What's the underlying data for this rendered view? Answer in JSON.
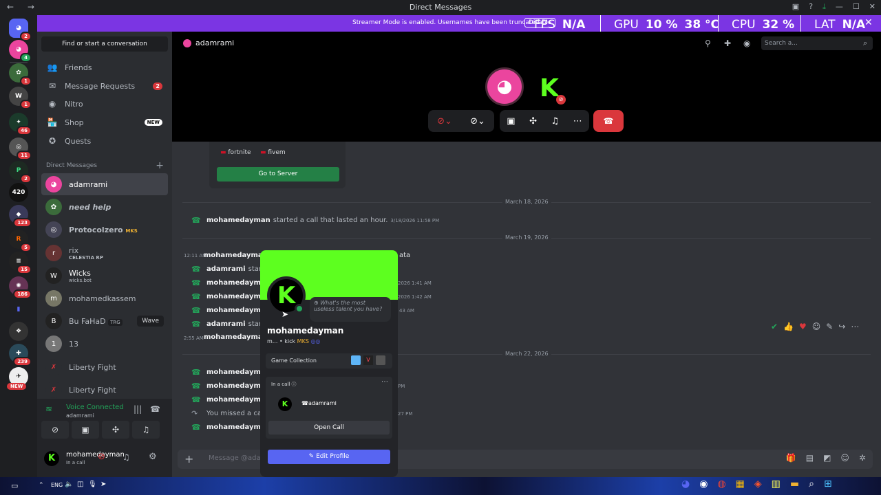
{
  "window": {
    "title": "Direct Messages",
    "nav": "← →"
  },
  "streamer": {
    "message": "Streamer Mode is enabled. Usernames have been truncated.",
    "disable": "Disable"
  },
  "hud": {
    "fps_label": "FPS",
    "fps": "N/A",
    "gpu_label": "GPU",
    "gpu_pct": "10 %",
    "gpu_temp": "38 °C",
    "cpu_label": "CPU",
    "cpu_pct": "32 %",
    "lat_label": "LAT",
    "lat": "N/A"
  },
  "guild_badges": [
    "2",
    "4",
    "1",
    "1",
    "46",
    "11",
    "2",
    "",
    "123",
    "5",
    "15",
    "186",
    "",
    "",
    "239",
    "NEW"
  ],
  "sidebar": {
    "find": "Find or start a conversation",
    "nav": [
      {
        "label": "Friends",
        "icon": "👥"
      },
      {
        "label": "Message Requests",
        "icon": "✉",
        "badge": "2"
      },
      {
        "label": "Nitro",
        "icon": "◉"
      },
      {
        "label": "Shop",
        "icon": "🏪",
        "badge_new": "NEW"
      },
      {
        "label": "Quests",
        "icon": "✪"
      }
    ],
    "dm_header": "Direct Messages",
    "dms": [
      {
        "name": "adamrami",
        "sub": ""
      },
      {
        "name": "need help",
        "sub": ""
      },
      {
        "name": "Protocolzero",
        "sub": "",
        "tag": "MKS"
      },
      {
        "name": "rix",
        "sub": "CELESTIA RP"
      },
      {
        "name": "Wicks",
        "sub": "wicks.bot"
      },
      {
        "name": "mohamedkassem",
        "sub": ""
      },
      {
        "name": "Bu FaHaD",
        "sub": "",
        "tag": "TRG",
        "extra": "Wave"
      },
      {
        "name": "13",
        "sub": ""
      },
      {
        "name": "Liberty Fight",
        "sub": ""
      },
      {
        "name": "Liberty Fight",
        "sub": ""
      }
    ]
  },
  "voice": {
    "status": "Voice Connected",
    "channel": "adamrami"
  },
  "user": {
    "name": "mohamedayman",
    "status": "In a call"
  },
  "channel": {
    "name": "adamrami",
    "search": "Search a..."
  },
  "server_card": {
    "tags": [
      "fortnite",
      "fivem"
    ],
    "button": "Go to Server"
  },
  "dates": [
    "March 18, 2026",
    "March 19, 2026",
    "March 22, 2026"
  ],
  "messages": [
    {
      "time": "",
      "name": "mohamedayman",
      "text": "started a call that lasted an hour.",
      "ts": "3/18/2026 11:58 PM"
    },
    {
      "time": "12:11 AM",
      "name": "mohamedayman",
      "text": "",
      "ts": "",
      "suffix": "ata"
    },
    {
      "time": "",
      "name": "adamrami",
      "text": "starte",
      "ts": ""
    },
    {
      "time": "",
      "name": "mohamedayman",
      "text": "",
      "ts": "2026 1:41 AM"
    },
    {
      "time": "",
      "name": "mohamedayman",
      "text": "",
      "ts": "2026 1:42 AM"
    },
    {
      "time": "",
      "name": "mohamedayman",
      "text": "",
      "ts": "43 AM"
    },
    {
      "time": "",
      "name": "adamrami",
      "text": "starte",
      "ts": ""
    },
    {
      "time": "2:55 AM",
      "name": "mohamedayman",
      "text": "",
      "ts": ""
    },
    {
      "time": "",
      "name": "mohamedayman",
      "text": "",
      "ts": ""
    },
    {
      "time": "",
      "name": "mohamedayman",
      "text": "",
      "ts": "PM"
    },
    {
      "time": "",
      "name": "mohamedayman",
      "text": "",
      "ts": ""
    },
    {
      "time": "",
      "name": "",
      "text": "You missed a call",
      "ts": "27 PM"
    },
    {
      "time": "",
      "name": "mohamedayman",
      "text": "",
      "ts": ""
    }
  ],
  "profile": {
    "name": "mohamedayman",
    "sub": "m... • kick",
    "tag": "MKS",
    "status_q": "What's the most useless talent you have?",
    "game_collection": "Game Collection",
    "in_call": "In a call",
    "call_user": "adamrami",
    "open_call": "Open Call",
    "edit": "Edit Profile"
  },
  "composer": {
    "placeholder": "Message @adam"
  },
  "taskbar": {
    "lang": "ENG"
  }
}
